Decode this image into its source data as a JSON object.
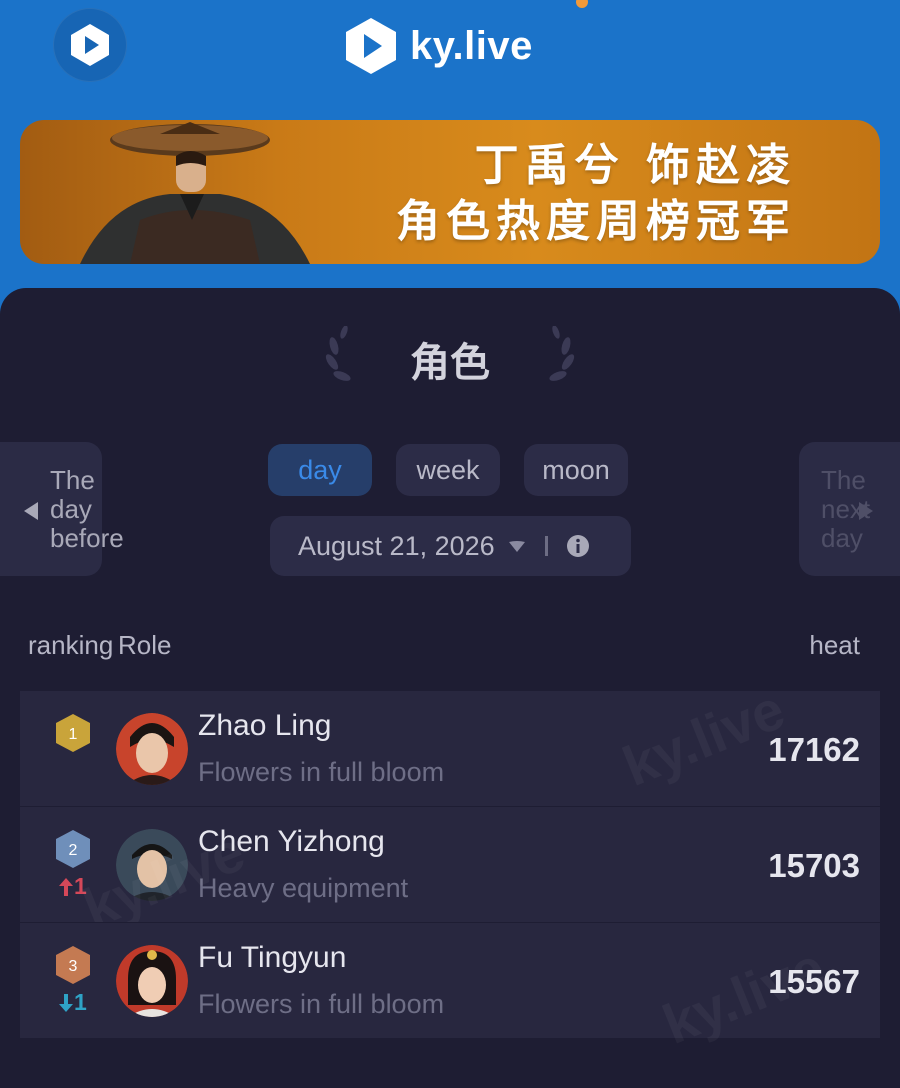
{
  "header": {
    "brand": "ky.live"
  },
  "banner": {
    "line1": "丁禹兮 饰赵凌",
    "line2": "角色热度周榜冠军"
  },
  "panel": {
    "title": "角色"
  },
  "nav": {
    "prev": [
      "The",
      "day",
      "before"
    ],
    "next": [
      "The",
      "next",
      "day"
    ]
  },
  "tabs": [
    {
      "label": "day",
      "active": true
    },
    {
      "label": "week",
      "active": false
    },
    {
      "label": "moon",
      "active": false
    }
  ],
  "date": {
    "value": "August 21, 2026"
  },
  "table": {
    "headers": {
      "ranking": "ranking",
      "role": "Role",
      "heat": "heat"
    },
    "rows": [
      {
        "rank": "1",
        "name": "Zhao Ling",
        "drama": "Flowers in full bloom",
        "heat": "17162",
        "trend": "",
        "trend_value": "",
        "badge_color": "#c9a43a"
      },
      {
        "rank": "2",
        "name": "Chen Yizhong",
        "drama": "Heavy equipment",
        "heat": "15703",
        "trend": "up",
        "trend_value": "1",
        "badge_color": "#6f8fba"
      },
      {
        "rank": "3",
        "name": "Fu Tingyun",
        "drama": "Flowers in full bloom",
        "heat": "15567",
        "trend": "down",
        "trend_value": "1",
        "badge_color": "#c47a52"
      }
    ]
  },
  "watermark": "ky.live"
}
